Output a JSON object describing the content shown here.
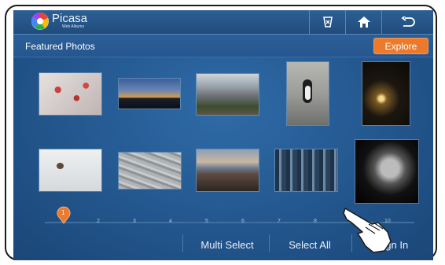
{
  "app": {
    "title": "Picasa",
    "subtitle": "Web Albums"
  },
  "toolbar": {
    "icons": [
      "glass-icon",
      "home-icon",
      "back-icon"
    ]
  },
  "section": {
    "title": "Featured Photos",
    "explore_label": "Explore"
  },
  "photos": [
    "red berries in snow",
    "city skyline at dusk",
    "city street",
    "penguin on rocks",
    "hanging light bulb",
    "bird on a twig",
    "sandy ripples",
    "rocky coastline at sunset",
    "misty forest",
    "cat silhouette"
  ],
  "timeline": {
    "ticks": [
      "1",
      "2",
      "3",
      "4",
      "5",
      "6",
      "7",
      "8",
      "9",
      "10"
    ],
    "current": "1"
  },
  "bottom": {
    "multi_select": "Multi Select",
    "select_all": "Select All",
    "sign_in": "Sign In"
  },
  "colors": {
    "accent": "#ec7a2a",
    "background": "#255a92"
  }
}
